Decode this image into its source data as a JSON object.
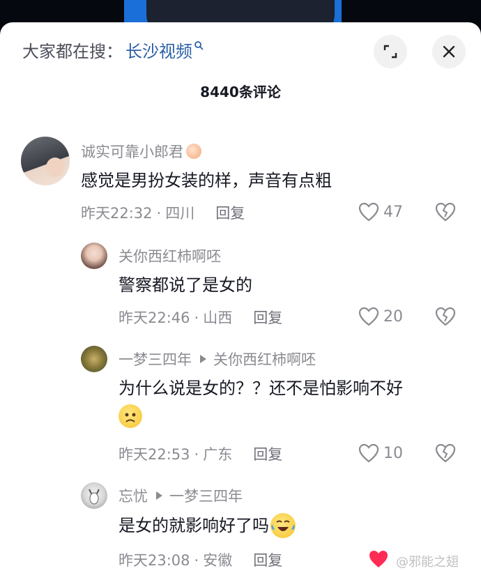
{
  "search": {
    "label": "大家都在搜：",
    "term": "长沙视频"
  },
  "comments_count": "8440条评论",
  "comments": [
    {
      "user": "诚实可靠小郎君",
      "text": "感觉是男扮女装的样，声音有点粗",
      "time": "昨天22:32",
      "location": "四川",
      "reply": "回复",
      "likes": "47"
    },
    {
      "user": "关你西红柿啊呸",
      "text": "警察都说了是女的",
      "time": "昨天22:46",
      "location": "山西",
      "reply": "回复",
      "likes": "20"
    },
    {
      "user": "一梦三四年",
      "reply_to": "关你西红柿啊呸",
      "text": "为什么说是女的？？还不是怕影响不好",
      "time": "昨天22:53",
      "location": "广东",
      "reply": "回复",
      "likes": "10"
    },
    {
      "user": "忘忧",
      "reply_to": "一梦三四年",
      "text": "是女的就影响好了吗",
      "time": "昨天23:08",
      "location": "安徽",
      "reply": "回复",
      "likes": ""
    }
  ],
  "watermark": "@邪能之翅",
  "colors": {
    "accent": "#2a5fa6",
    "like_active": "#fe2c55",
    "muted": "#8a8b91"
  }
}
